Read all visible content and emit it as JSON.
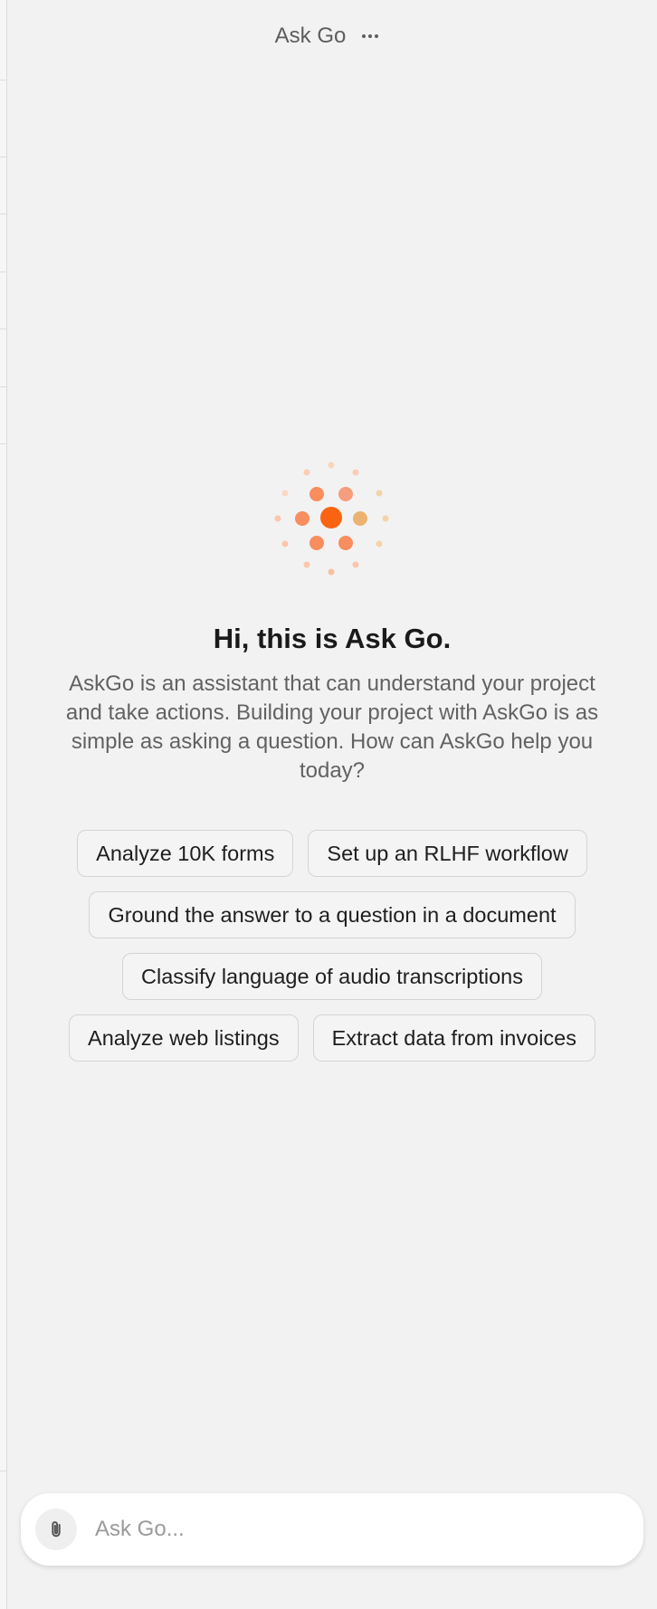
{
  "header": {
    "title": "Ask Go",
    "more_icon": "more-horizontal-icon"
  },
  "hero": {
    "logo_icon": "orange-dots-burst-icon",
    "title": "Hi, this is Ask Go.",
    "description": "AskGo is an assistant that can understand your project and take actions. Building your project with AskGo is as simple as asking a question. How can AskGo help you today?"
  },
  "suggestions": [
    "Analyze 10K forms",
    "Set up an RLHF workflow",
    "Ground the answer to a question in a document",
    "Classify language of audio transcriptions",
    "Analyze web listings",
    "Extract data from invoices"
  ],
  "composer": {
    "placeholder": "Ask Go...",
    "attach_icon": "paperclip-icon"
  },
  "colors": {
    "accent": "#fa6311",
    "background": "#f2f2f2"
  }
}
